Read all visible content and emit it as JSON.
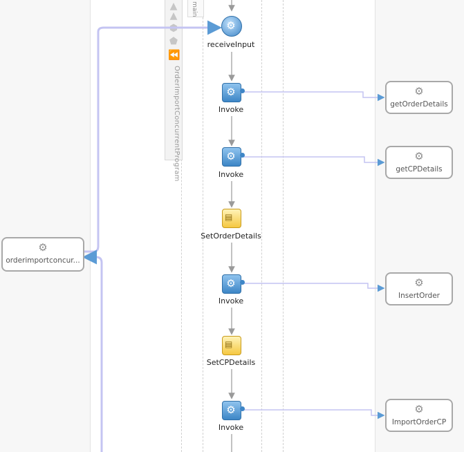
{
  "toolbar": {
    "label": "OrderImportConcurrentProgram",
    "icons": [
      "triangle-up-icon",
      "triangle-up-icon",
      "hexagon-icon",
      "pentagon-icon",
      "double-chevron-left-icon"
    ]
  },
  "scope": {
    "label": "main"
  },
  "client_partner": {
    "name": "orderimportconcur..."
  },
  "activities": [
    {
      "type": "receive",
      "label": "receiveInput"
    },
    {
      "type": "invoke",
      "label": "Invoke"
    },
    {
      "type": "invoke",
      "label": "Invoke"
    },
    {
      "type": "assign",
      "label": "SetOrderDetails"
    },
    {
      "type": "invoke",
      "label": "Invoke"
    },
    {
      "type": "assign",
      "label": "SetCPDetails"
    },
    {
      "type": "invoke",
      "label": "Invoke"
    }
  ],
  "partners": [
    {
      "name": "getOrderDetails"
    },
    {
      "name": "getCPDetails"
    },
    {
      "name": "InsertOrder"
    },
    {
      "name": "ImportOrderCP"
    }
  ],
  "colors": {
    "link": "#b3b3f0",
    "link_arrow": "#5b9bd5",
    "flow": "#9a9a9a",
    "invoke_fill": "#3d86c6",
    "assign_fill": "#f5c842"
  }
}
